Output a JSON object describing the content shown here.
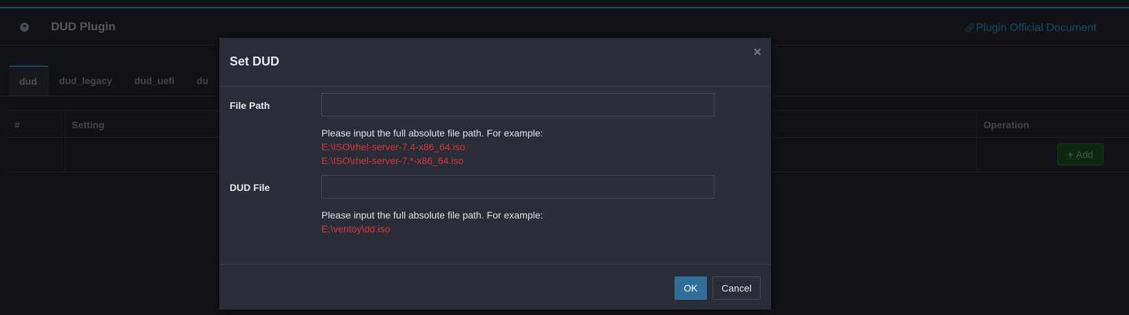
{
  "header": {
    "title": "DUD Plugin",
    "doc_link": "Plugin Official Document",
    "globe_icon": "globe-icon",
    "link_icon": "link-icon"
  },
  "tabs": [
    {
      "label": "dud",
      "active": true
    },
    {
      "label": "dud_legacy",
      "active": false
    },
    {
      "label": "dud_uefi",
      "active": false
    },
    {
      "label": "du",
      "active": false
    }
  ],
  "table": {
    "columns": [
      "#",
      "Setting",
      "Operation"
    ],
    "add_label": "Add",
    "add_icon": "plus-icon"
  },
  "modal": {
    "title": "Set DUD",
    "close_label": "×",
    "file_path": {
      "label": "File Path",
      "value": "",
      "hint": "Please input the full absolute file path. For example:",
      "examples": [
        "E:\\ISO\\rhel-server-7.4-x86_64.iso",
        "E:\\ISO\\rhel-server-7.*-x86_64.iso"
      ]
    },
    "dud_file": {
      "label": "DUD File",
      "value": "",
      "hint": "Please input the full absolute file path. For example:",
      "examples": [
        "E:\\ventoy\\dd.iso"
      ]
    },
    "ok_label": "OK",
    "cancel_label": "Cancel"
  },
  "colors": {
    "accent": "#2f6f99",
    "example_text": "#d6363c",
    "add_button": "#0f2612"
  }
}
